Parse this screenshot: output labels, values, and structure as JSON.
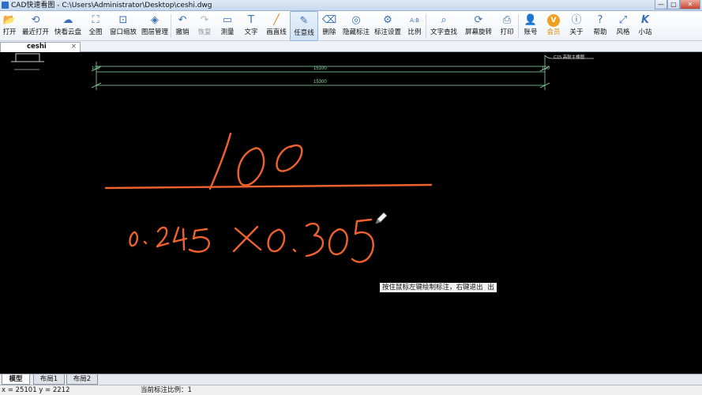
{
  "window": {
    "title": "CAD快速看图 - C:\\Users\\Administrator\\Desktop\\ceshi.dwg",
    "min_glyph": "—",
    "max_glyph": "□",
    "close_glyph": "✕"
  },
  "toolbar": {
    "items": [
      {
        "label": "打开",
        "icon": "folder-icon",
        "glyph": "📂"
      },
      {
        "label": "最近打开",
        "icon": "history-icon",
        "glyph": "⟲"
      },
      {
        "label": "快看云盘",
        "icon": "cloud-icon",
        "glyph": "☁"
      },
      {
        "label": "全图",
        "icon": "fit-icon",
        "glyph": "⛶"
      },
      {
        "label": "窗口缩放",
        "icon": "zoom-window-icon",
        "glyph": "⊡"
      },
      {
        "label": "图层管理",
        "icon": "layers-icon",
        "glyph": "◈"
      },
      {
        "label": "撤销",
        "icon": "undo-icon",
        "glyph": "↶"
      },
      {
        "label": "恢复",
        "icon": "redo-icon",
        "glyph": "↷"
      },
      {
        "label": "测量",
        "icon": "measure-icon",
        "glyph": "▭"
      },
      {
        "label": "文字",
        "icon": "text-icon",
        "glyph": "T"
      },
      {
        "label": "画直线",
        "icon": "line-icon",
        "glyph": "╱"
      },
      {
        "label": "任意线",
        "icon": "pen-icon",
        "glyph": "✎"
      },
      {
        "label": "删除",
        "icon": "eraser-icon",
        "glyph": "⌫"
      },
      {
        "label": "隐藏标注",
        "icon": "eye-hide-icon",
        "glyph": "◎"
      },
      {
        "label": "标注设置",
        "icon": "annotation-settings-icon",
        "glyph": "⚙"
      },
      {
        "label": "比例",
        "icon": "scale-icon",
        "glyph": "A:B"
      },
      {
        "label": "文字查找",
        "icon": "text-search-icon",
        "glyph": "⌕"
      },
      {
        "label": "屏幕旋转",
        "icon": "rotate-screen-icon",
        "glyph": "⟳"
      },
      {
        "label": "打印",
        "icon": "printer-icon",
        "glyph": "⎙"
      },
      {
        "label": "账号",
        "icon": "user-icon",
        "glyph": "👤"
      },
      {
        "label": "会员",
        "icon": "vip-icon",
        "glyph": "V"
      },
      {
        "label": "关于",
        "icon": "info-icon",
        "glyph": "ⓘ"
      },
      {
        "label": "帮助",
        "icon": "help-icon",
        "glyph": "?"
      },
      {
        "label": "风格",
        "icon": "style-icon",
        "glyph": "⤢"
      },
      {
        "label": "小站",
        "icon": "site-logo-icon",
        "glyph": "K"
      }
    ]
  },
  "document_tab": {
    "label": "ceshi",
    "close": "×"
  },
  "drawing": {
    "dimension_left": "100",
    "dimension_right": "100",
    "dimension_mid": "15100",
    "dimension_total": "15300",
    "title_block_text": "C15 高耐主楼图"
  },
  "tooltip": "按住鼠标左键绘制标注，右键退出",
  "tooltip_tail": "出",
  "layout_tabs": [
    "模型",
    "布局1",
    "布局2"
  ],
  "status": {
    "coords": "x = 25101  y = 2212",
    "scale": "当前标注比例：1"
  },
  "colors": {
    "canvas": "#000000",
    "sketch": "#f0622d",
    "dimension": "#8fd9a8",
    "accent": "#3a6fb6"
  }
}
